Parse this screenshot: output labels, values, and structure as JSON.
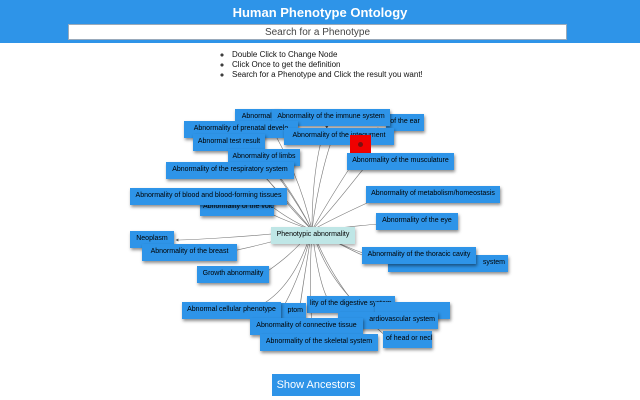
{
  "header": {
    "title": "Human Phenotype Ontology",
    "search_placeholder": "Search for a Phenotype"
  },
  "instructions": [
    "Double Click to Change Node",
    "Click Once to get the definition",
    "Search for a Phenotype and Click the result you want!"
  ],
  "graph": {
    "root": "Phenotypic abnormality",
    "nodes": [
      "Abnormali",
      "Abnormality of the immune system",
      "of the ear",
      "Abnormality of prenatal develo",
      "Abnormality of the integument",
      "Abnormal test result",
      "Abnormality of limbs",
      "Abnormality of the musculature",
      "Abnormality of the respiratory system",
      "Abnormality of metabolism/homeostasis",
      "Abnormality of blood and blood-forming tissues",
      "Abnormality of the voice",
      "Abnormality of the eye",
      "Neoplasm",
      "Abnormality of the breast",
      "Abnormality of the thoracic cavity",
      "system",
      "Growth abnormality",
      "Abnormal cellular phenotype",
      "lity of the digestive system",
      "ptom",
      "ardiovascular system",
      "Abnormality of connective tissue",
      "of head or neck",
      "Abnormality of the skeletal system"
    ]
  },
  "colors": {
    "header": "#2e94e8",
    "node": "#2e94e8",
    "root_node": "#bfe6e6",
    "selected_marker": "#f00000"
  },
  "buttons": {
    "show_ancestors": "Show Ancestors"
  }
}
